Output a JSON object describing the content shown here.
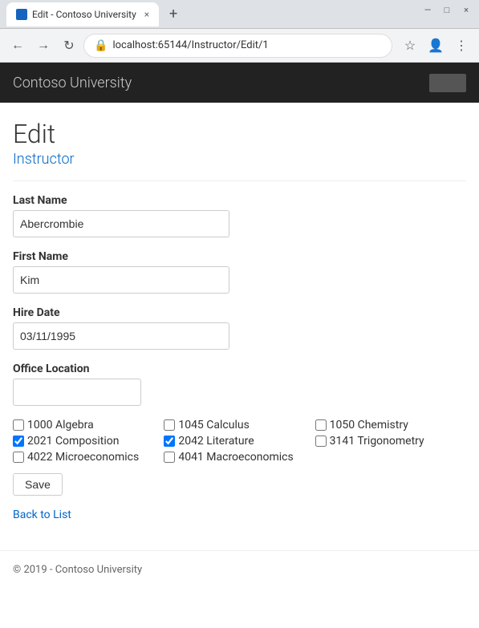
{
  "browser": {
    "tab_title": "Edit - Contoso University",
    "tab_close": "×",
    "tab_new": "+",
    "url": "localhost:65144/Instructor/Edit/1",
    "lock_icon": "🔒",
    "star_icon": "☆",
    "account_icon": "👤",
    "menu_icon": "⋮",
    "back_icon": "←",
    "forward_icon": "→",
    "reload_icon": "↻",
    "minimize_icon": "—",
    "maximize_icon": "□",
    "close_icon": "×"
  },
  "app": {
    "title": "Contoso University",
    "btn_label": ""
  },
  "page": {
    "heading": "Edit",
    "subheading": "Instructor",
    "last_name_label": "Last Name",
    "last_name_value": "Abercrombie",
    "first_name_label": "First Name",
    "first_name_value": "Kim",
    "hire_date_label": "Hire Date",
    "hire_date_value": "03/11/1995",
    "office_location_label": "Office Location",
    "office_location_value": "",
    "save_btn": "Save",
    "back_link": "Back to List"
  },
  "courses": [
    {
      "id": "1000",
      "name": "Algebra",
      "checked": false
    },
    {
      "id": "1045",
      "name": "Calculus",
      "checked": false
    },
    {
      "id": "1050",
      "name": "Chemistry",
      "checked": false
    },
    {
      "id": "2021",
      "name": "Composition",
      "checked": true
    },
    {
      "id": "2042",
      "name": "Literature",
      "checked": true
    },
    {
      "id": "3141",
      "name": "Trigonometry",
      "checked": false
    },
    {
      "id": "4022",
      "name": "Microeconomics",
      "checked": false
    },
    {
      "id": "4041",
      "name": "Macroeconomics",
      "checked": false
    }
  ],
  "footer": {
    "text": "© 2019 - Contoso University"
  }
}
